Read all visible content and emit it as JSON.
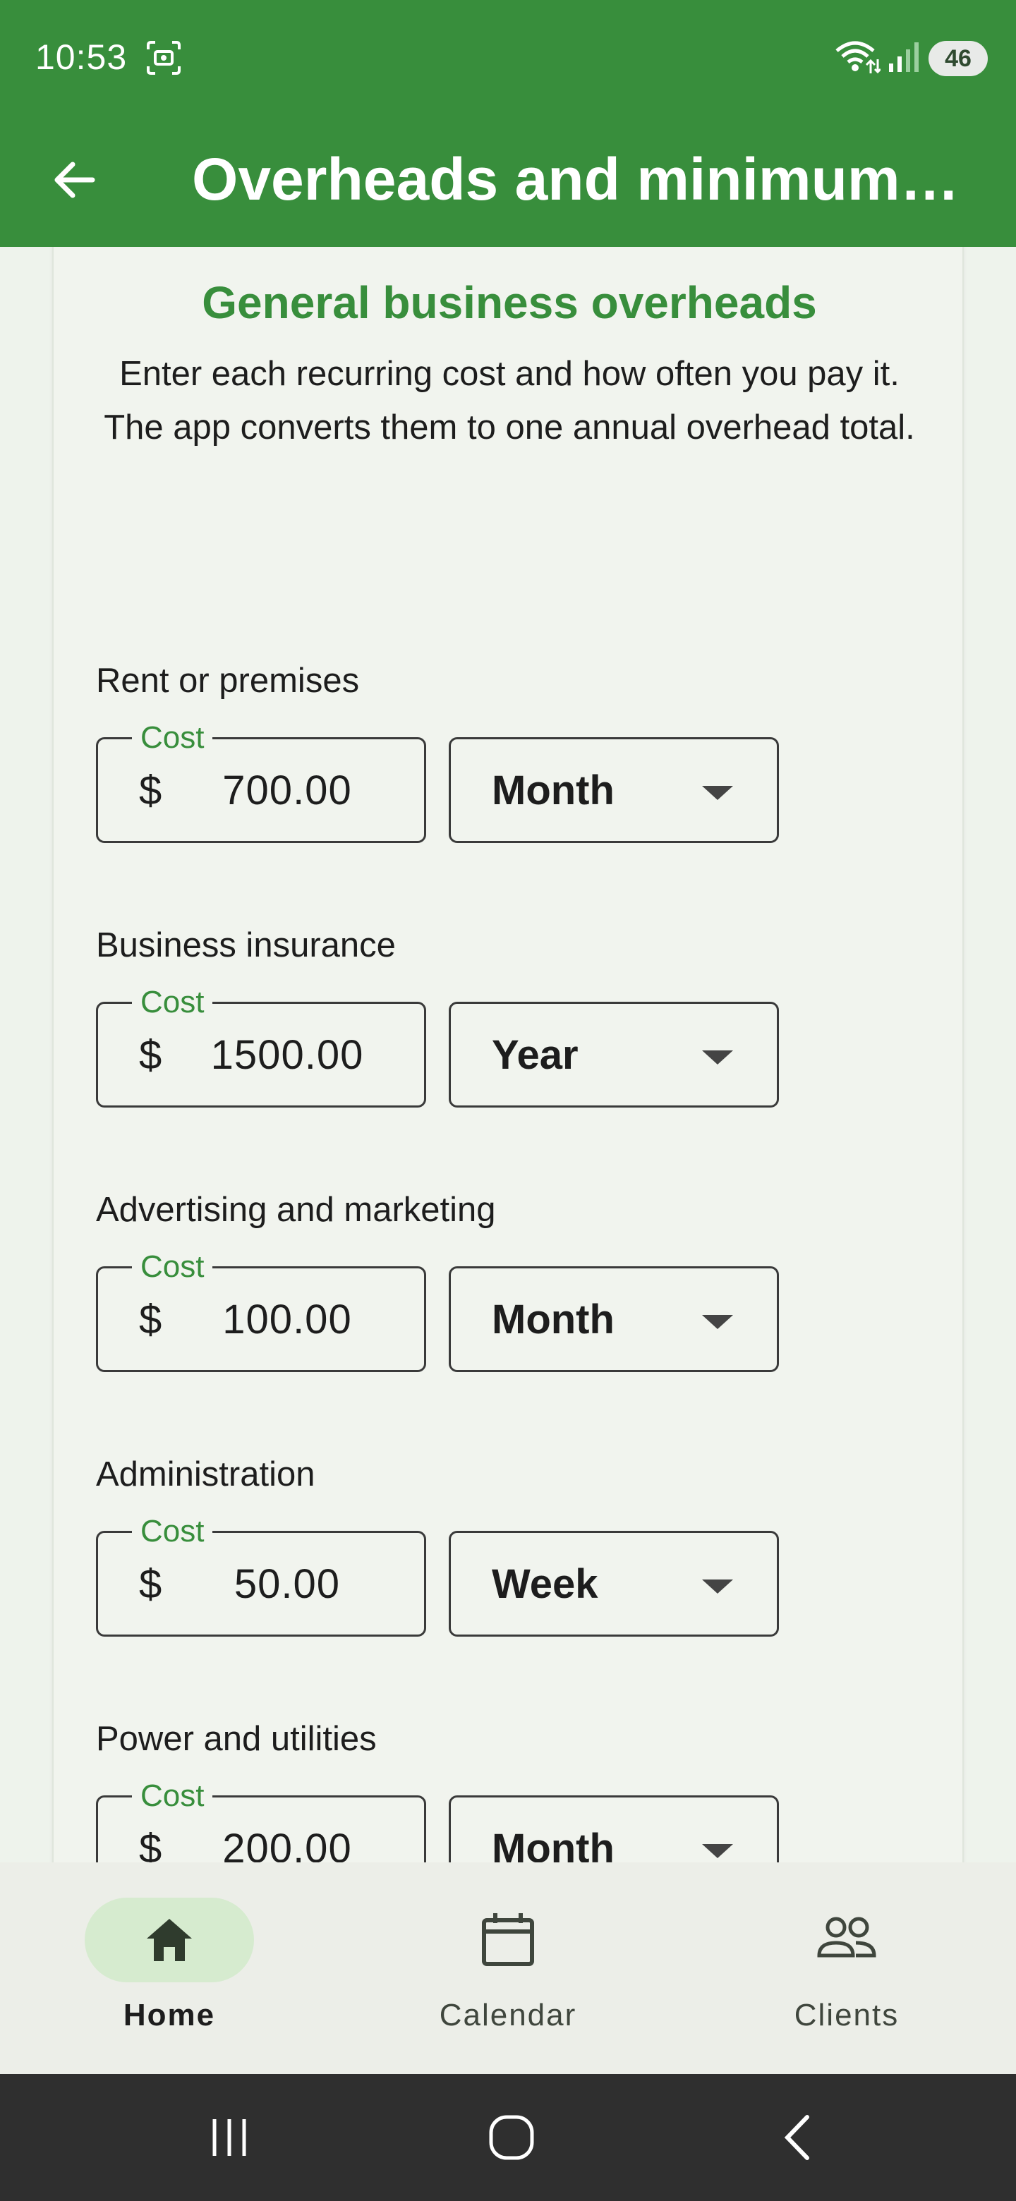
{
  "status_bar": {
    "time": "10:53",
    "battery": "46"
  },
  "app_bar": {
    "title": "Overheads and minimum …",
    "back_icon": "arrow-left-icon"
  },
  "card": {
    "title": "General business overheads",
    "description_line1": "Enter each recurring cost and how often you pay it.",
    "description_line2": "The app converts them to one annual overhead total."
  },
  "items": [
    {
      "label": "Rent or premises",
      "cost_legend": "Cost",
      "currency": "$",
      "cost": "700.00",
      "period": "Month"
    },
    {
      "label": "Business insurance",
      "cost_legend": "Cost",
      "currency": "$",
      "cost": "1500.00",
      "period": "Year"
    },
    {
      "label": "Advertising and marketing",
      "cost_legend": "Cost",
      "currency": "$",
      "cost": "100.00",
      "period": "Month"
    },
    {
      "label": "Administration",
      "cost_legend": "Cost",
      "currency": "$",
      "cost": "50.00",
      "period": "Week"
    },
    {
      "label": "Power and utilities",
      "cost_legend": "Cost",
      "currency": "$",
      "cost": "200.00",
      "period": "Month"
    }
  ],
  "bottom_nav": {
    "items": [
      {
        "label": "Home",
        "icon": "home-icon",
        "active": true
      },
      {
        "label": "Calendar",
        "icon": "calendar-icon",
        "active": false
      },
      {
        "label": "Clients",
        "icon": "people-icon",
        "active": false
      }
    ]
  },
  "colors": {
    "primary": "#388e3c",
    "active_pill": "#d6ebcf",
    "card_bg": "#f1f4ee"
  }
}
